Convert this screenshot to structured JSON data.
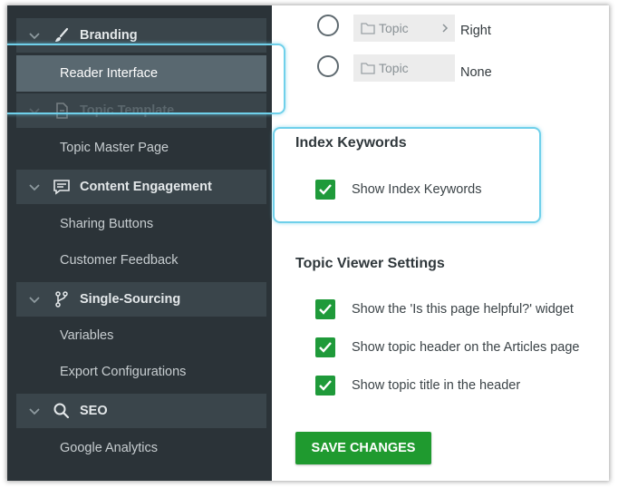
{
  "sidebar": {
    "sections": [
      {
        "label": "Branding",
        "icon": "paintbrush-icon"
      },
      {
        "label": "Topic Template",
        "icon": "document-icon"
      },
      {
        "label": "Content Engagement",
        "icon": "comment-icon"
      },
      {
        "label": "Single-Sourcing",
        "icon": "branch-icon"
      },
      {
        "label": "SEO",
        "icon": "search-icon"
      }
    ],
    "items": {
      "reader_interface": "Reader Interface",
      "topic_master_page": "Topic Master Page",
      "sharing_buttons": "Sharing Buttons",
      "customer_feedback": "Customer Feedback",
      "variables": "Variables",
      "export_configurations": "Export Configurations",
      "google_analytics": "Google Analytics"
    }
  },
  "position_options": [
    {
      "topic_label": "Topic",
      "position_label": "Right"
    },
    {
      "topic_label": "Topic",
      "position_label": "None"
    }
  ],
  "index_keywords": {
    "heading": "Index Keywords",
    "show_label": "Show Index Keywords",
    "checked": true
  },
  "topic_viewer": {
    "heading": "Topic Viewer Settings",
    "options": [
      {
        "label": "Show the 'Is this page helpful?' widget",
        "checked": true
      },
      {
        "label": "Show topic header on the Articles page",
        "checked": true
      },
      {
        "label": "Show topic title in the header",
        "checked": true
      }
    ]
  },
  "save_button_label": "SAVE CHANGES",
  "colors": {
    "sidebar_bg": "#2b3338",
    "section_bg": "#3a454b",
    "active_item_bg": "#596870",
    "checkbox_green": "#1f9a3a",
    "save_green": "#1f9a2f",
    "callout": "#6fd0ea"
  }
}
